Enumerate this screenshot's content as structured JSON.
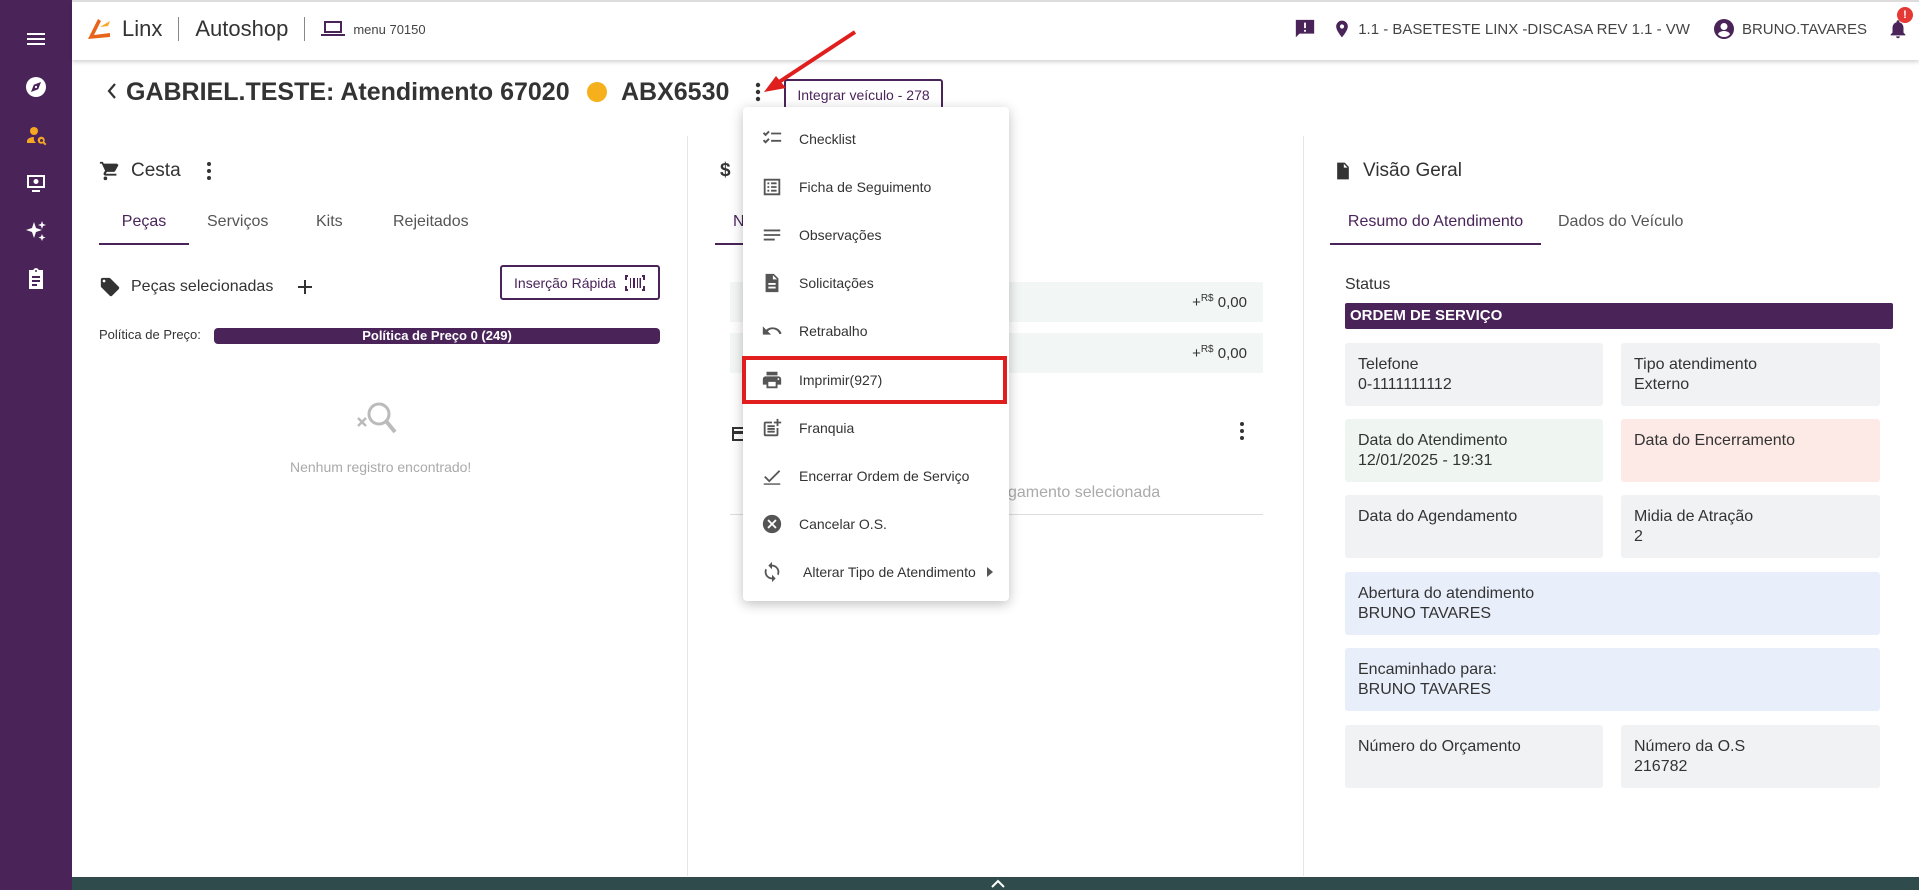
{
  "app": {
    "brand1": "Linx",
    "brand2": "Autoshop",
    "menu_code": "menu 70150"
  },
  "topbar": {
    "location": "1.1 - BASETESTE LINX -DISCASA REV 1.1 - VW",
    "user": "BRUNO.TAVARES",
    "notification_badge": "!"
  },
  "header": {
    "title": "GABRIEL.TESTE: Atendimento 67020",
    "plate": "ABX6530",
    "integrate_button": "Integrar veículo - 278",
    "status_color": "#f5b01b"
  },
  "cesta": {
    "title": "Cesta",
    "tabs": [
      "Peças",
      "Serviços",
      "Kits",
      "Rejeitados"
    ],
    "selected_label": "Peças selecionadas",
    "quick_insert": "Inserção Rápida",
    "price_policy_label": "Política de Preço:",
    "price_policy_value": "Política de Preço 0 (249)",
    "empty": "Nenhum registro encontrado!"
  },
  "middle": {
    "currency_icon": "$",
    "tab_partial": "N",
    "rows": [
      {
        "prefix": "+",
        "currency": "R$",
        "value": "0,00"
      },
      {
        "prefix": "+",
        "currency": "R$",
        "value": "0,00"
      }
    ],
    "faded": "gamento selecionada"
  },
  "overview": {
    "title": "Visão Geral",
    "tabs": [
      "Resumo do Atendimento",
      "Dados do Veículo"
    ],
    "status_label": "Status",
    "status_value": "ORDEM DE SERVIÇO",
    "cards": {
      "telefone_label": "Telefone",
      "telefone_value": "0-1111111112",
      "tipo_label": "Tipo atendimento",
      "tipo_value": "Externo",
      "data_atend_label": "Data do Atendimento",
      "data_atend_value": "12/01/2025 - 19:31",
      "data_enc_label": "Data do Encerramento",
      "data_agend_label": "Data do Agendamento",
      "midia_label": "Midia de Atração",
      "midia_value": "2",
      "abertura_label": "Abertura do atendimento",
      "abertura_value": "BRUNO TAVARES",
      "encaminhado_label": "Encaminhado para:",
      "encaminhado_value": "BRUNO TAVARES",
      "num_orc_label": "Número do Orçamento",
      "num_os_label": "Número da O.S",
      "num_os_value": "216782"
    }
  },
  "menu": {
    "items": [
      {
        "label": "Checklist",
        "icon": "checklist-icon"
      },
      {
        "label": "Ficha de Seguimento",
        "icon": "list-icon"
      },
      {
        "label": "Observações",
        "icon": "notes-icon"
      },
      {
        "label": "Solicitações",
        "icon": "document-icon"
      },
      {
        "label": "Retrabalho",
        "icon": "undo-icon"
      },
      {
        "label": "Imprimir(927)",
        "icon": "print-icon"
      },
      {
        "label": "Franquia",
        "icon": "post-add-icon"
      },
      {
        "label": "Encerrar Ordem de Serviço",
        "icon": "check-icon"
      },
      {
        "label": "Cancelar O.S.",
        "icon": "cancel-icon"
      },
      {
        "label": "Alterar Tipo de Atendimento",
        "icon": "sync-icon"
      }
    ]
  },
  "colors": {
    "primary": "#4a2459",
    "accent": "#f5a623",
    "highlight": "#e01e1e"
  }
}
